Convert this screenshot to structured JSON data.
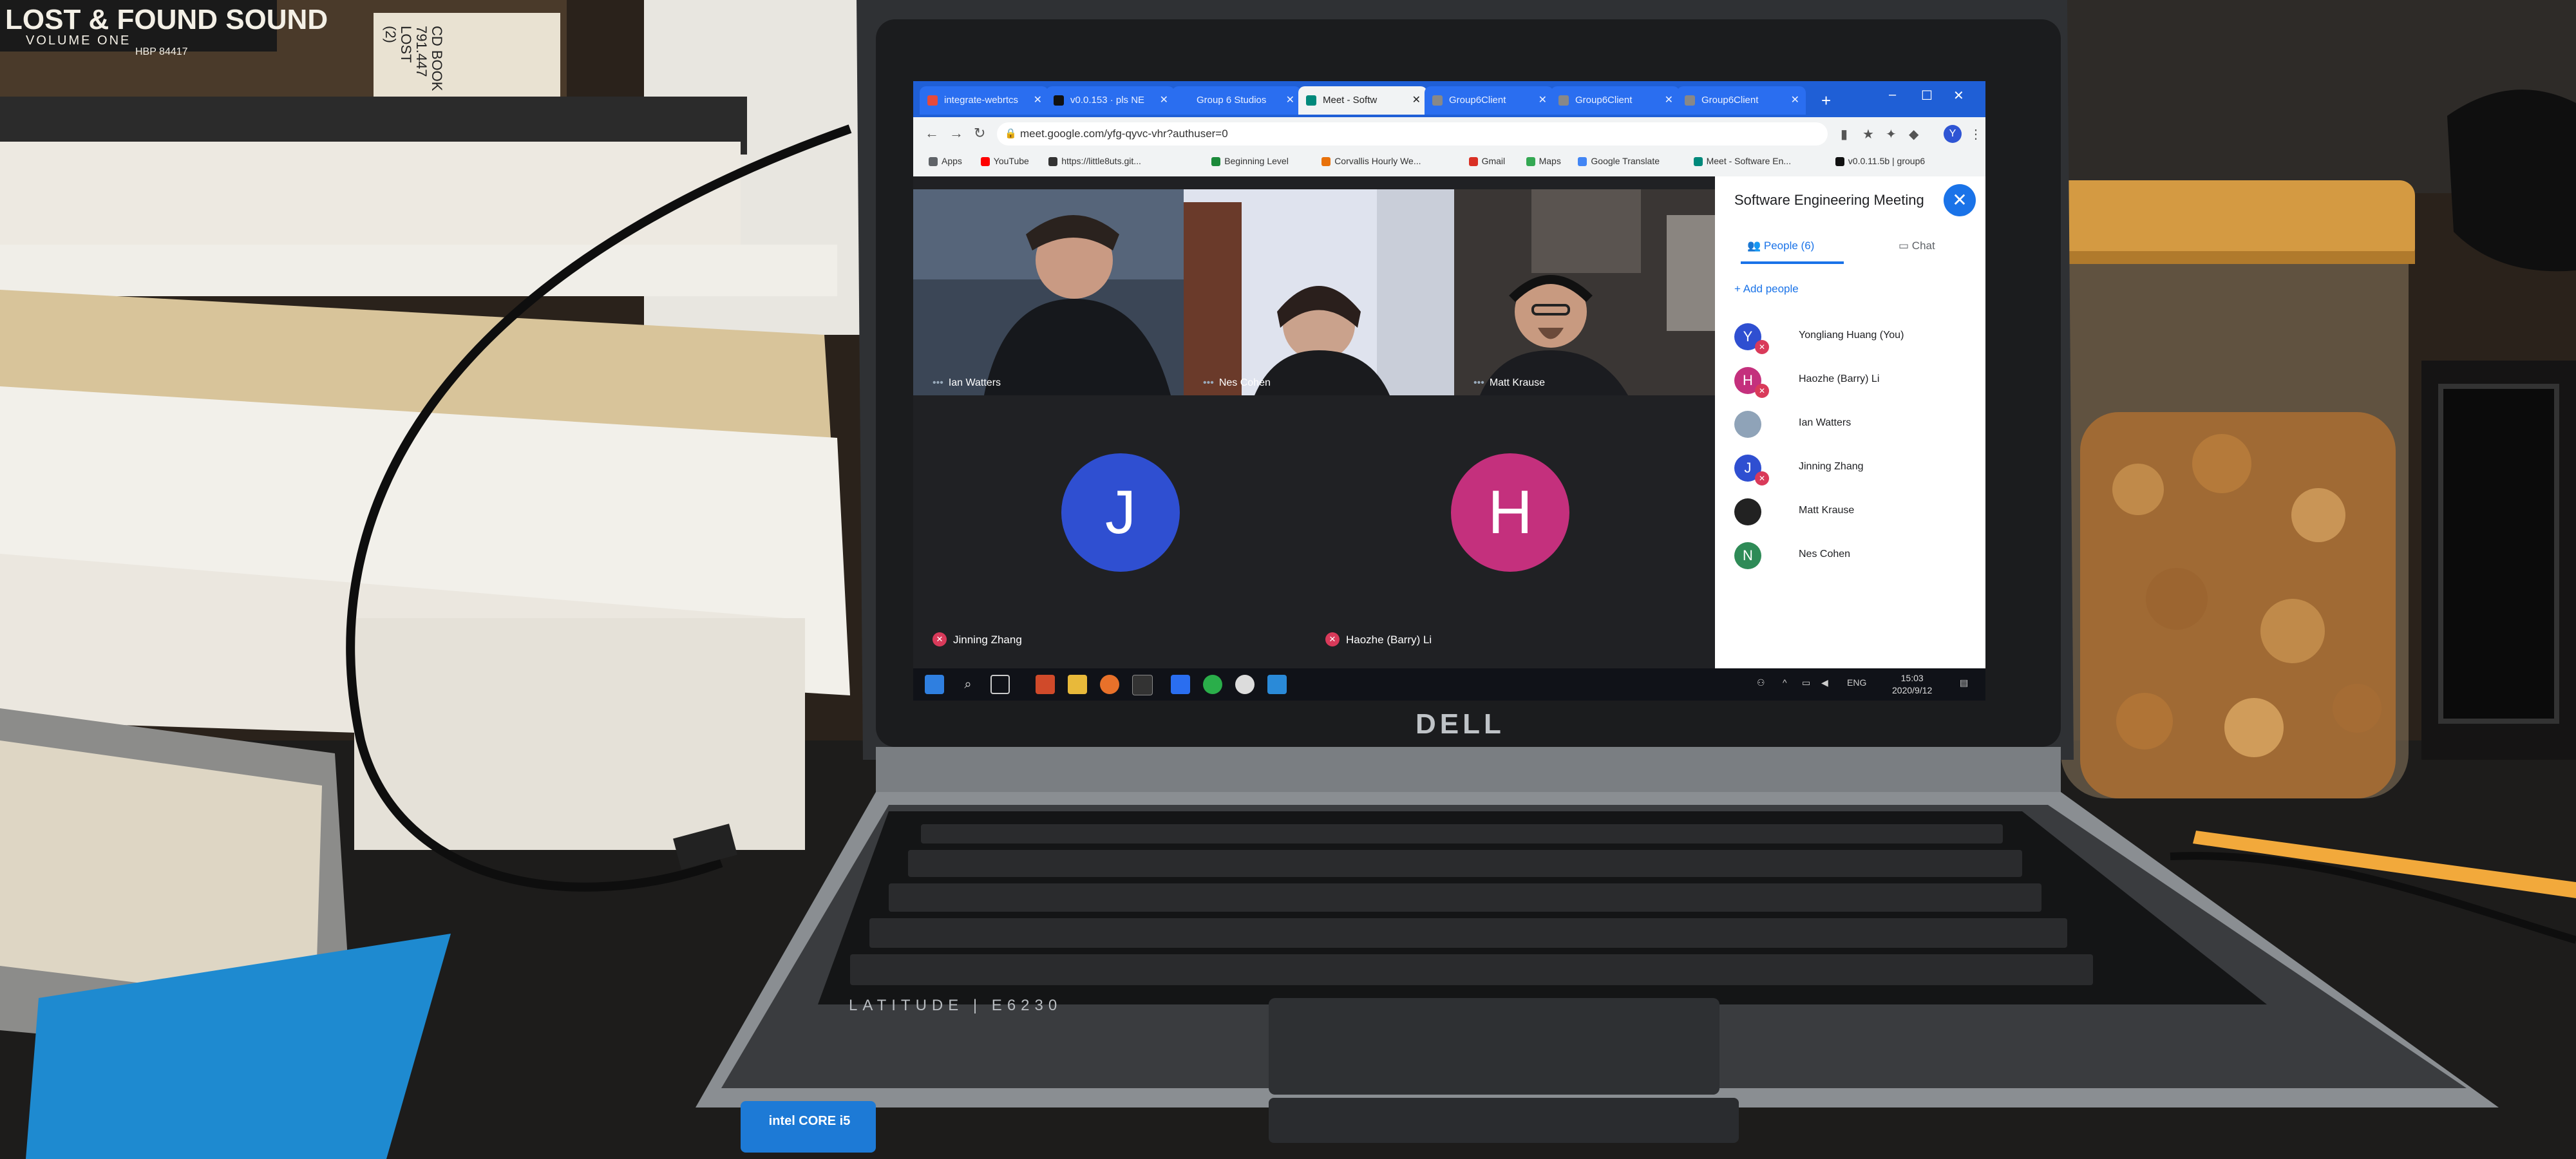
{
  "photo": {
    "book_spine_title": "LOST & FOUND SOUND",
    "book_spine_sub": "VOLUME ONE",
    "book_spine_code": "HBP 84417",
    "cd_book_label": "CD BOOK\n791.447\nLOST\n(2)",
    "laptop_brand": "DELL",
    "laptop_model": "LATITUDE | E6230",
    "sticker_text": "intel CORE i5"
  },
  "browser": {
    "tabs": [
      {
        "label": "integrate-webrtcs",
        "color": "#e64a3b"
      },
      {
        "label": "v0.0.153 · pls NE",
        "color": "#111111"
      },
      {
        "label": "Group 6 Studios",
        "color": "#2a6ef0"
      },
      {
        "label": "Meet - Softw",
        "color": "#00897b",
        "active": true
      },
      {
        "label": "Group6Client",
        "color": "#888888"
      },
      {
        "label": "Group6Client",
        "color": "#888888"
      },
      {
        "label": "Group6Client",
        "color": "#888888"
      }
    ],
    "new_tab": "+",
    "url": "meet.google.com/yfg-qyvc-vhr?authuser=0",
    "bookmarks": [
      {
        "label": "Apps",
        "color": "#5f6368"
      },
      {
        "label": "YouTube",
        "color": "#ff0000"
      },
      {
        "label": "https://little8uts.git...",
        "color": "#333333"
      },
      {
        "label": "Beginning Level",
        "color": "#1b8a3a"
      },
      {
        "label": "Corvallis Hourly We...",
        "color": "#e8710a"
      },
      {
        "label": "Gmail",
        "color": "#d93025"
      },
      {
        "label": "Maps",
        "color": "#34a853"
      },
      {
        "label": "Google Translate",
        "color": "#4285f4"
      },
      {
        "label": "Meet - Software En...",
        "color": "#00897b"
      },
      {
        "label": "v0.0.11.5b | group6",
        "color": "#111111"
      }
    ]
  },
  "meet": {
    "tiles": [
      {
        "name": "Ian Watters"
      },
      {
        "name": "Nes Cohen"
      },
      {
        "name": "Matt Krause"
      }
    ],
    "avatars": [
      {
        "initial": "J",
        "name": "Jinning Zhang",
        "color": "#2f4fd1"
      },
      {
        "initial": "H",
        "name": "Haozhe (Barry) Li",
        "color": "#c4307d"
      }
    ]
  },
  "panel": {
    "title": "Software Engineering Meeting",
    "close": "✕",
    "tab_people": "People (6)",
    "tab_chat": "Chat",
    "add_people": "Add people",
    "people": [
      {
        "initial": "Y",
        "name": "Yongliang Huang (You)",
        "color": "#2f4fd1",
        "muted": true
      },
      {
        "initial": "H",
        "name": "Haozhe (Barry) Li",
        "color": "#c4307d",
        "muted": true
      },
      {
        "initial": "",
        "name": "Ian Watters",
        "color": "#8fa3b8",
        "muted": false
      },
      {
        "initial": "J",
        "name": "Jinning Zhang",
        "color": "#2f4fd1",
        "muted": true
      },
      {
        "initial": "",
        "name": "Matt Krause",
        "color": "#222222",
        "muted": false
      },
      {
        "initial": "N",
        "name": "Nes Cohen",
        "color": "#2e8b57",
        "muted": false
      }
    ]
  },
  "taskbar": {
    "lang": "ENG",
    "time": "15:03",
    "date": "2020/9/12"
  }
}
